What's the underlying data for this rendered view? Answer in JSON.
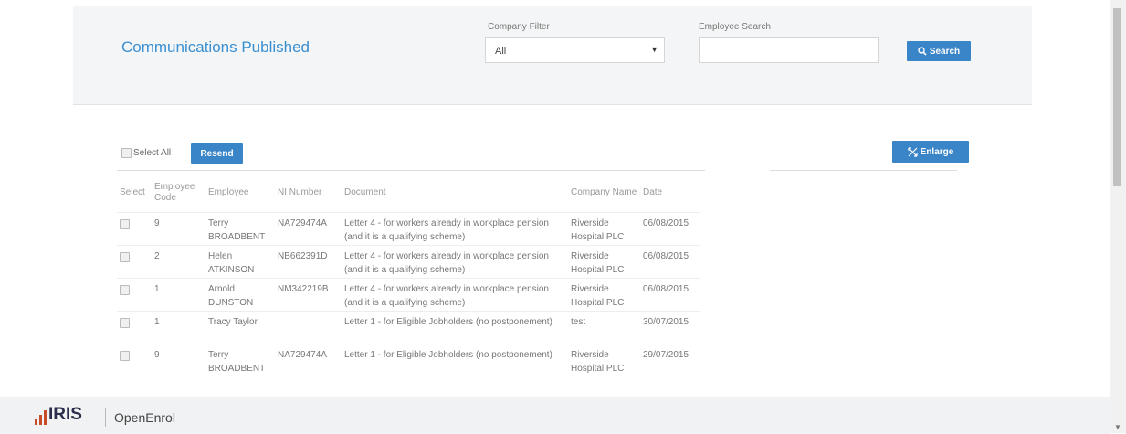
{
  "header": {
    "title": "Communications Published",
    "company_filter_label": "Company Filter",
    "company_filter_value": "All",
    "employee_search_label": "Employee Search",
    "employee_search_value": "",
    "search_button": "Search"
  },
  "toolbar": {
    "select_all_label": "Select All",
    "resend_label": "Resend",
    "enlarge_label": "Enlarge"
  },
  "table": {
    "columns": [
      "Select",
      "Employee Code",
      "Employee",
      "NI Number",
      "Document",
      "Company Name",
      "Date"
    ],
    "rows": [
      {
        "code": "9",
        "employee": "Terry BROADBENT",
        "ni": "NA729474A",
        "document": "Letter 4 - for workers already in workplace pension (and it is a qualifying scheme)",
        "company": "Riverside Hospital PLC",
        "date": "06/08/2015"
      },
      {
        "code": "2",
        "employee": "Helen ATKINSON",
        "ni": "NB662391D",
        "document": "Letter 4 - for workers already in workplace pension (and it is a qualifying scheme)",
        "company": "Riverside Hospital PLC",
        "date": "06/08/2015"
      },
      {
        "code": "1",
        "employee": "Arnold DUNSTON",
        "ni": "NM342219B",
        "document": "Letter 4 - for workers already in workplace pension (and it is a qualifying scheme)",
        "company": "Riverside Hospital PLC",
        "date": "06/08/2015"
      },
      {
        "code": "1",
        "employee": "Tracy Taylor",
        "ni": "",
        "document": "Letter 1 - for Eligible Jobholders (no postponement)",
        "company": "test",
        "date": "30/07/2015"
      },
      {
        "code": "9",
        "employee": "Terry BROADBENT",
        "ni": "NA729474A",
        "document": "Letter 1 - for Eligible Jobholders (no postponement)",
        "company": "Riverside Hospital PLC",
        "date": "29/07/2015"
      }
    ]
  },
  "footer": {
    "logo": "IRIS",
    "product": "OpenEnrol"
  },
  "colors": {
    "accent": "#3a85c8",
    "title": "#3a8fd1",
    "logo_red": "#c84c27",
    "logo_navy": "#2a2e4a"
  }
}
